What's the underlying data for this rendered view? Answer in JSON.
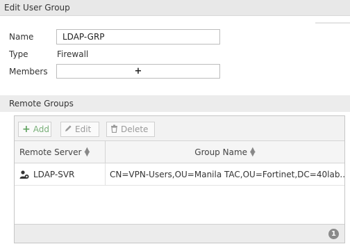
{
  "window": {
    "title": "Edit User Group"
  },
  "form": {
    "name_label": "Name",
    "name_value": "LDAP-GRP",
    "type_label": "Type",
    "type_value": "Firewall",
    "members_label": "Members",
    "members_add": "+"
  },
  "remote_groups": {
    "section_title": "Remote Groups",
    "toolbar": {
      "add_icon": "+",
      "add_label": "Add",
      "edit_label": "Edit",
      "delete_label": "Delete"
    },
    "columns": [
      "Remote Server",
      "Group Name"
    ],
    "rows": [
      {
        "remote_server": "LDAP-SVR",
        "group_name": "CN=VPN-Users,OU=Manila TAC,OU=Fortinet,DC=40lab..."
      }
    ],
    "count": "1"
  },
  "colors": {
    "accent_add": "#5ea25e",
    "header_bg": "#e8e8e8",
    "badge_bg": "#8a8a8a"
  }
}
